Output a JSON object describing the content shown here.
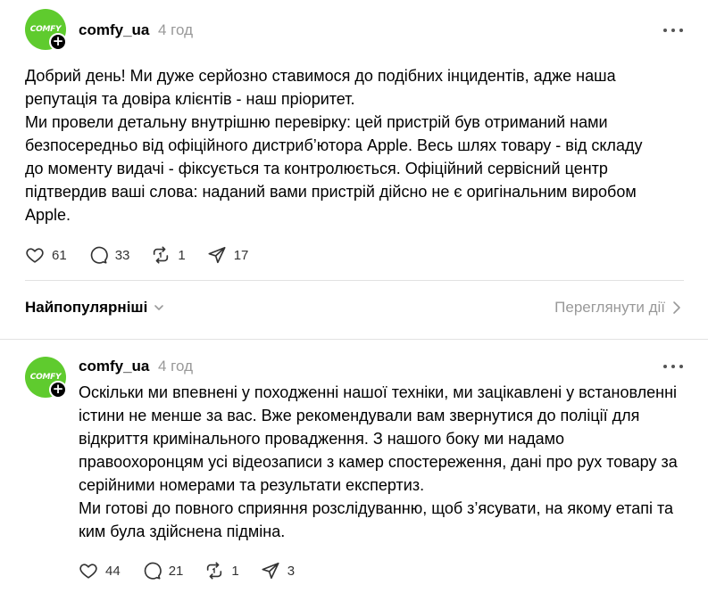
{
  "post1": {
    "avatar_text": "COMFY",
    "username": "comfy_ua",
    "time": "4 год",
    "paragraphs": [
      "Добрий день! Ми дуже серйозно ставимося до подібних інцидентів, адже наша репутація та довіра клієнтів - наш пріоритет.",
      "Ми провели детальну внутрішню перевірку: цей пристрій був отриманий нами безпосередньо від офіційного дистриб’ютора Apple. Весь шлях товару - від складу до моменту видачі - фіксується та контролюється. Офіційний сервісний центр підтвердив ваші слова: наданий вами пристрій дійсно не є оригінальним виробом Apple."
    ],
    "likes": "61",
    "replies": "33",
    "reposts": "1",
    "shares": "17"
  },
  "sort": {
    "label": "Найпопулярніші",
    "view_activity": "Переглянути дії"
  },
  "post2": {
    "avatar_text": "COMFY",
    "username": "comfy_ua",
    "time": "4 год",
    "paragraphs": [
      "Оскільки ми впевнені у походженні нашої техніки, ми зацікавлені у встановленні істини не менше за вас. Вже рекомендували вам звернутися до поліції для відкриття кримінального провадження. З нашого боку ми надамо правоохоронцям усі відеозаписи з камер спостереження, дані про рух товару за серійними номерами та результати експертиз.",
      "Ми готові до повного сприяння розслідуванню, щоб з’ясувати, на якому етапі та ким була здійснена підміна."
    ],
    "likes": "44",
    "replies": "21",
    "reposts": "1",
    "shares": "3"
  },
  "colors": {
    "brand_green": "#5fcb2e",
    "muted_text": "#999999",
    "divider": "#e2e2e2"
  },
  "icons": [
    "heart-icon",
    "comment-icon",
    "repost-icon",
    "share-icon",
    "more-icon",
    "chevron-down-icon",
    "chevron-right-icon",
    "plus-icon"
  ]
}
